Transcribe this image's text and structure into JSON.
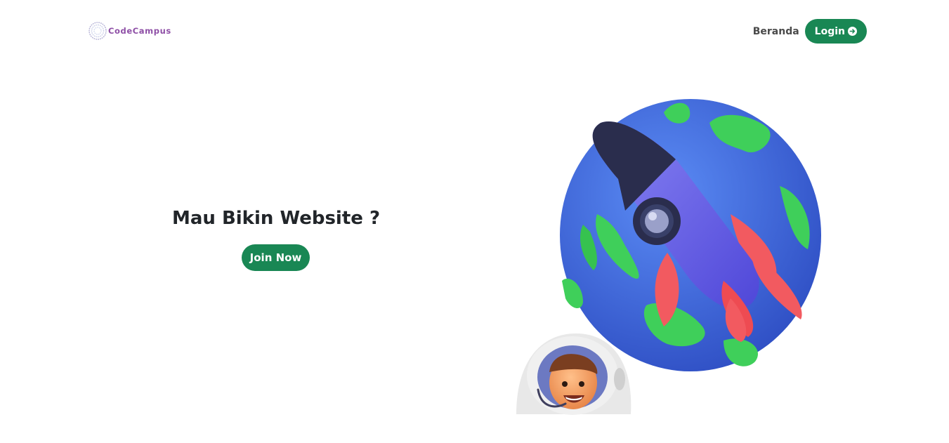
{
  "brand": {
    "name": "CodeCampus",
    "icon": "dotted-ring-logo-icon"
  },
  "nav": {
    "links": [
      {
        "label": "Beranda"
      }
    ],
    "login": {
      "label": "Login",
      "icon": "arrow-right-circle-icon"
    }
  },
  "hero": {
    "title": "Mau Bikin Website ?",
    "cta": "Join Now",
    "illustration": "rocket-globe-astronaut-illustration"
  },
  "colors": {
    "primary": "#198754",
    "brand_text": "#8e4fa6",
    "heading": "#212529",
    "nav_text": "#4a4a4a"
  }
}
